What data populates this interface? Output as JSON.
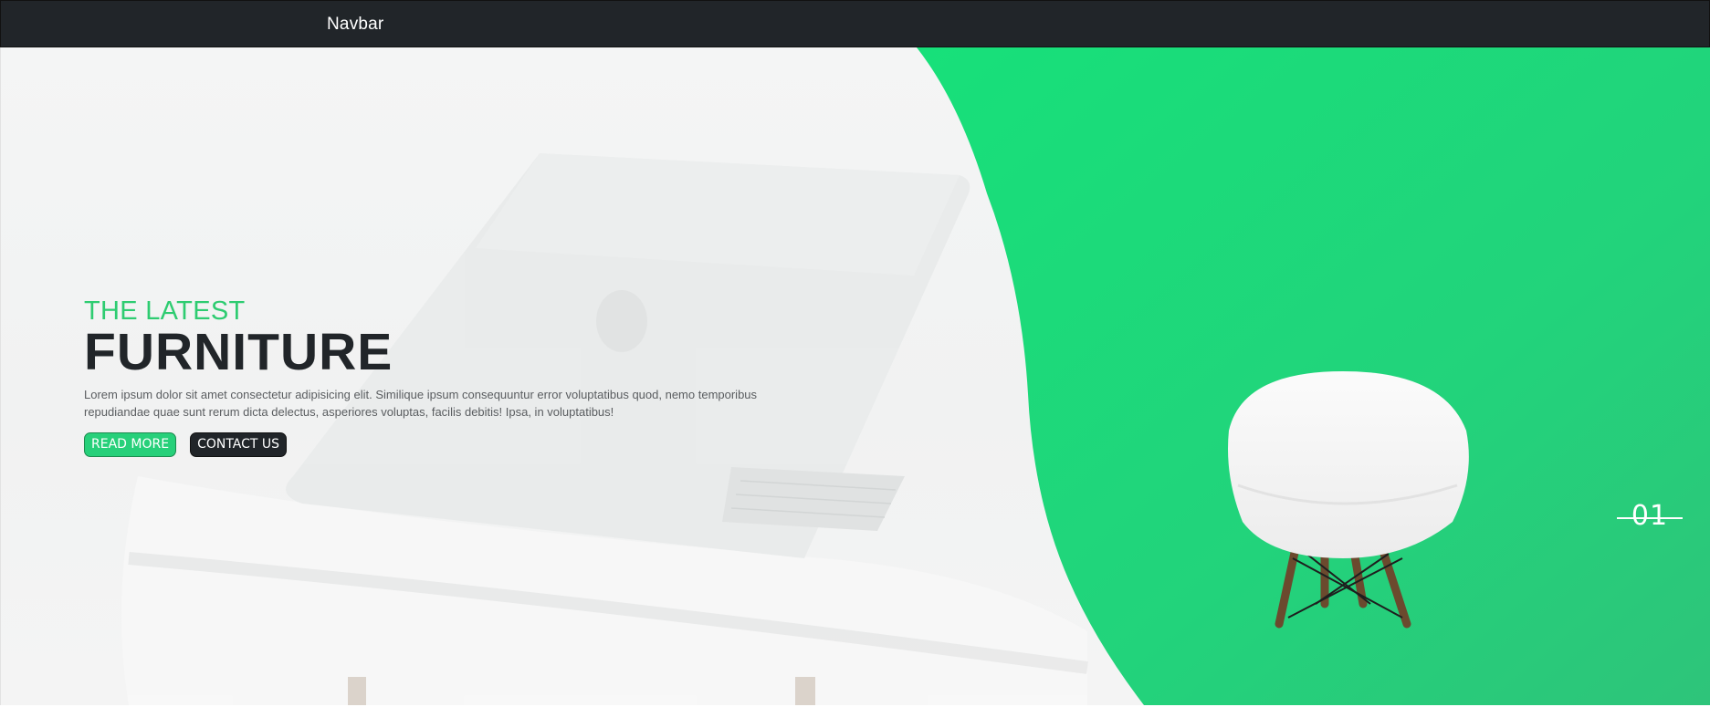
{
  "navbar": {
    "brand": "Navbar"
  },
  "hero": {
    "subtitle": "THE LATEST",
    "title": "FURNITURE",
    "description": "Lorem ipsum dolor sit amet consectetur adipisicing elit. Similique ipsum consequuntur error voluptatibus quod, nemo temporibus repudiandae quae sunt rerum dicta delectus, asperiores voluptas, facilis debitis! Ipsa, in voluptatibus!",
    "read_more_label": "READ MORE",
    "contact_label": "CONTACT US",
    "slide_number": "01"
  },
  "colors": {
    "accent": "#2ecc71",
    "dark": "#212529",
    "green_panel": "#1fd87a"
  }
}
